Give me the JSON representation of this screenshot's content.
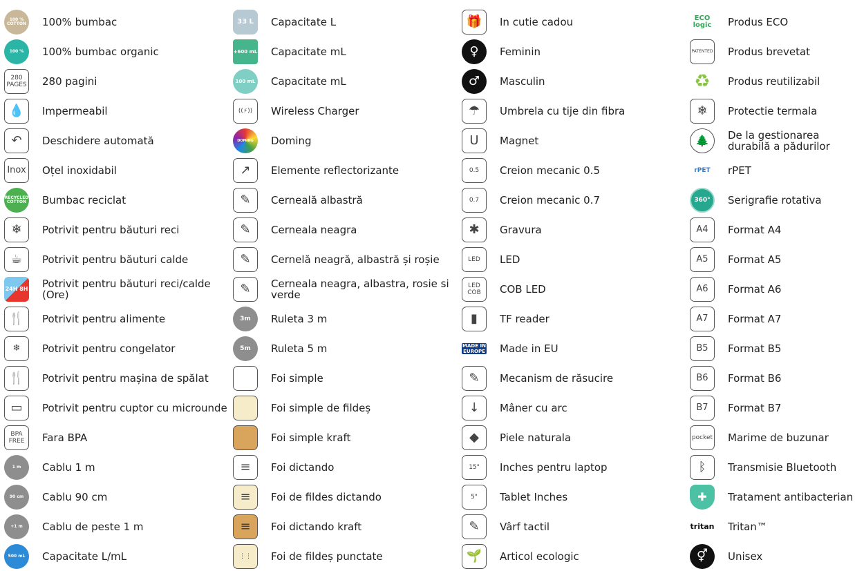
{
  "columns": [
    [
      {
        "label": "100% bumbac",
        "icon": "cotton-icon",
        "glyph": "100 %\nCOTTON"
      },
      {
        "label": "100% bumbac organic",
        "icon": "organic-cotton-icon",
        "glyph": "100 %"
      },
      {
        "label": "280 pagini",
        "icon": "pages-icon",
        "glyph": "280\nPAGES"
      },
      {
        "label": "Impermeabil",
        "icon": "waterproof-icon",
        "glyph": "💧"
      },
      {
        "label": "Deschidere automată",
        "icon": "auto-open-umbrella-icon",
        "glyph": "↶"
      },
      {
        "label": "Oțel inoxidabil",
        "icon": "inox-icon",
        "glyph": "Inox"
      },
      {
        "label": "Bumbac reciclat",
        "icon": "recycled-cotton-icon",
        "glyph": "RECYCLED\nCOTTON"
      },
      {
        "label": "Potrivit pentru băuturi reci",
        "icon": "cold-drink-icon",
        "glyph": "❄"
      },
      {
        "label": "Potrivit pentru băuturi calde",
        "icon": "hot-drink-icon",
        "glyph": "☕"
      },
      {
        "label": "Potrivit pentru băuturi reci/calde (Ore)",
        "icon": "hot-cold-hours-icon",
        "glyph": "24H 8H"
      },
      {
        "label": "Potrivit pentru alimente",
        "icon": "food-safe-icon",
        "glyph": "🍴"
      },
      {
        "label": "Potrivit pentru congelator",
        "icon": "freezer-icon",
        "glyph": "❄"
      },
      {
        "label": "Potrivit pentru mașina de spălat",
        "icon": "dishwasher-icon",
        "glyph": "🍴"
      },
      {
        "label": "Potrivit pentru cuptor cu microunde",
        "icon": "microwave-icon",
        "glyph": "▭"
      },
      {
        "label": "Fara BPA",
        "icon": "bpa-free-icon",
        "glyph": "BPA\nFREE"
      },
      {
        "label": "Cablu 1 m",
        "icon": "cable-1m-icon",
        "glyph": "1 m"
      },
      {
        "label": "Cablu 90 cm",
        "icon": "cable-90cm-icon",
        "glyph": "90 cm"
      },
      {
        "label": "Cablu de peste 1 m",
        "icon": "cable-over-1m-icon",
        "glyph": "+1 m"
      },
      {
        "label": "Capacitate L/mL",
        "icon": "capacity-drop-icon",
        "glyph": "500 mL"
      }
    ],
    [
      {
        "label": "Capacitate L",
        "icon": "capacity-l-icon",
        "glyph": "33 L"
      },
      {
        "label": "Capacitate mL",
        "icon": "capacity-jar-icon",
        "glyph": "+600 mL"
      },
      {
        "label": "Capacitate mL",
        "icon": "capacity-drop-ml-icon",
        "glyph": "100 mL"
      },
      {
        "label": "Wireless Charger",
        "icon": "wireless-charger-icon",
        "glyph": "((⚡))"
      },
      {
        "label": "Doming",
        "icon": "doming-icon",
        "glyph": "DOMING"
      },
      {
        "label": "Elemente reflectorizante",
        "icon": "reflective-icon",
        "glyph": "↗"
      },
      {
        "label": "Cerneală albastră",
        "icon": "blue-ink-icon",
        "glyph": "✎"
      },
      {
        "label": "Cerneala neagra",
        "icon": "black-ink-icon",
        "glyph": "✎"
      },
      {
        "label": "Cernelă neagră, albastră și roșie",
        "icon": "three-color-ink-icon",
        "glyph": "✎"
      },
      {
        "label": "Cerneala neagra, albastra, rosie si verde",
        "icon": "four-color-ink-icon",
        "glyph": "✎"
      },
      {
        "label": "Ruleta 3 m",
        "icon": "tape-3m-icon",
        "glyph": "3m"
      },
      {
        "label": "Ruleta 5 m",
        "icon": "tape-5m-icon",
        "glyph": "5m"
      },
      {
        "label": "Foi simple",
        "icon": "blank-sheets-icon",
        "glyph": ""
      },
      {
        "label": "Foi simple de fildeș",
        "icon": "ivory-sheets-icon",
        "glyph": ""
      },
      {
        "label": "Foi simple kraft",
        "icon": "kraft-sheets-icon",
        "glyph": ""
      },
      {
        "label": "Foi dictando",
        "icon": "lined-sheets-icon",
        "glyph": "≡"
      },
      {
        "label": "Foi de fildes dictando",
        "icon": "ivory-lined-sheets-icon",
        "glyph": "≡"
      },
      {
        "label": "Foi dictando kraft",
        "icon": "kraft-lined-sheets-icon",
        "glyph": "≡"
      },
      {
        "label": "Foi de fildeș punctate",
        "icon": "dotted-sheets-icon",
        "glyph": "⋮⋮"
      }
    ],
    [
      {
        "label": "In cutie cadou",
        "icon": "gift-box-icon",
        "glyph": "🎁"
      },
      {
        "label": "Feminin",
        "icon": "female-icon",
        "glyph": "♀"
      },
      {
        "label": "Masculin",
        "icon": "male-icon",
        "glyph": "♂"
      },
      {
        "label": "Umbrela cu tije din fibra",
        "icon": "fiber-umbrella-icon",
        "glyph": "☂"
      },
      {
        "label": "Magnet",
        "icon": "magnet-icon",
        "glyph": "U"
      },
      {
        "label": "Creion mecanic 0.5",
        "icon": "pencil-05-icon",
        "glyph": "0.5"
      },
      {
        "label": "Creion mecanic 0.7",
        "icon": "pencil-07-icon",
        "glyph": "0.7"
      },
      {
        "label": "Gravura",
        "icon": "laser-engraving-icon",
        "glyph": "✱"
      },
      {
        "label": "LED",
        "icon": "led-icon",
        "glyph": "LED"
      },
      {
        "label": "COB LED",
        "icon": "cob-led-icon",
        "glyph": "LED\nCOB"
      },
      {
        "label": "TF reader",
        "icon": "tf-card-icon",
        "glyph": "▮"
      },
      {
        "label": "Made in EU",
        "icon": "made-in-europe-icon",
        "glyph": "MADE IN\nEUROPE"
      },
      {
        "label": "Mecanism de răsucire",
        "icon": "twist-mechanism-icon",
        "glyph": "✎"
      },
      {
        "label": "Mâner cu arc",
        "icon": "spring-handle-icon",
        "glyph": "↓"
      },
      {
        "label": "Piele naturala",
        "icon": "leather-icon",
        "glyph": "◆"
      },
      {
        "label": "Inches pentru laptop",
        "icon": "laptop-inches-icon",
        "glyph": "15\""
      },
      {
        "label": "Tablet Inches",
        "icon": "tablet-inches-icon",
        "glyph": "5\""
      },
      {
        "label": "Vârf tactil",
        "icon": "touch-tip-icon",
        "glyph": "✎"
      },
      {
        "label": "Articol ecologic",
        "icon": "ecological-icon",
        "glyph": "🌱"
      }
    ],
    [
      {
        "label": "Produs ECO",
        "icon": "eco-logic-icon",
        "glyph": "ECO\nlogic"
      },
      {
        "label": "Produs brevetat",
        "icon": "patented-icon",
        "glyph": "PATENTED"
      },
      {
        "label": "Produs reutilizabil",
        "icon": "reusable-icon",
        "glyph": "♻"
      },
      {
        "label": "Protectie termala",
        "icon": "thermal-protection-icon",
        "glyph": "❄"
      },
      {
        "label": "De la gestionarea durabilă a pădurilor",
        "icon": "sustainable-forest-icon",
        "glyph": "🌲"
      },
      {
        "label": "rPET",
        "icon": "rpet-icon",
        "glyph": "rPET"
      },
      {
        "label": "Serigrafie rotativa",
        "icon": "rotary-print-icon",
        "glyph": "360°"
      },
      {
        "label": "Format A4",
        "icon": "format-a4-icon",
        "glyph": "A4"
      },
      {
        "label": "Format A5",
        "icon": "format-a5-icon",
        "glyph": "A5"
      },
      {
        "label": "Format A6",
        "icon": "format-a6-icon",
        "glyph": "A6"
      },
      {
        "label": "Format A7",
        "icon": "format-a7-icon",
        "glyph": "A7"
      },
      {
        "label": "Format B5",
        "icon": "format-b5-icon",
        "glyph": "B5"
      },
      {
        "label": "Format B6",
        "icon": "format-b6-icon",
        "glyph": "B6"
      },
      {
        "label": "Format B7",
        "icon": "format-b7-icon",
        "glyph": "B7"
      },
      {
        "label": "Marime de buzunar",
        "icon": "pocket-size-icon",
        "glyph": "pocket"
      },
      {
        "label": "Transmisie Bluetooth",
        "icon": "bluetooth-icon",
        "glyph": "ᛒ"
      },
      {
        "label": "Tratament antibacterian",
        "icon": "antibacterial-icon",
        "glyph": "✚"
      },
      {
        "label": "Tritan™",
        "icon": "tritan-icon",
        "glyph": "tritan"
      },
      {
        "label": "Unisex",
        "icon": "unisex-icon",
        "glyph": "⚥"
      }
    ]
  ],
  "styles": [
    [
      "circ beige tiny",
      "circ teal tiny",
      "sq small",
      "sq big",
      "sq big",
      "sq mid",
      "circ green tiny",
      "sq big",
      "sq big",
      "hr24",
      "sq big",
      "sq mid",
      "sq big",
      "sq big",
      "sq small",
      "circ grey tiny",
      "circ grey tiny",
      "circ grey tiny",
      "circ blue tiny"
    ],
    [
      "pale",
      "jar",
      "drop",
      "sq small",
      "circ doming",
      "sq big",
      "sq big",
      "sq big",
      "sq big",
      "sq big",
      "circ grey small",
      "circ grey small",
      "sq",
      "sq ivory",
      "sq kraft",
      "sq big",
      "sq big ivory",
      "sq big kraft",
      "sq small ivory"
    ],
    [
      "sq big",
      "black big",
      "black big",
      "sq big",
      "sq big",
      "sq small",
      "sq small",
      "sq big",
      "sq small",
      "sq tiny2",
      "sq big",
      "flag",
      "sq big",
      "sq big",
      "sq big",
      "sq small",
      "sq small",
      "sq big",
      "sq big"
    ],
    [
      "eco",
      "sq tiny",
      "reuse",
      "sq big",
      "forest",
      "rpet",
      "rot",
      "sq mid",
      "sq mid",
      "sq mid",
      "sq mid",
      "sq mid",
      "sq mid",
      "sq mid",
      "sq small",
      "sq big",
      "shield",
      "tritan",
      "black big"
    ]
  ]
}
